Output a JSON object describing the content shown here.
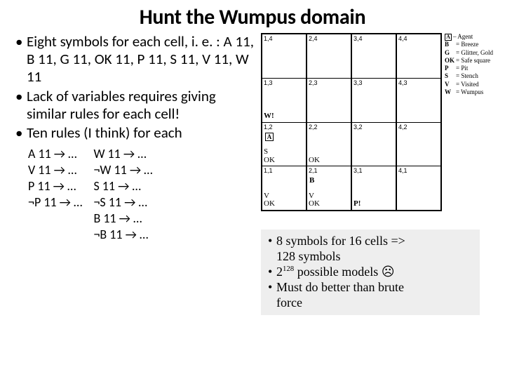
{
  "title": "Hunt the Wumpus domain",
  "bullets": {
    "b1": "Eight symbols for each cell, i. e. : A 11, B 11, G 11, OK 11, P 11, S 11, V 11, W 11",
    "b2": "Lack of variables requires giving similar rules for each cell!",
    "b3": "Ten rules (I think) for each"
  },
  "rules": {
    "c1": {
      "r1": "A 11 → …",
      "r2": "V 11 → …",
      "r3": "P 11 → …",
      "r4": "¬P 11 → …"
    },
    "c2": {
      "r1": "W 11 → …",
      "r2": "¬W 11 → …",
      "r3": "S 11 → …",
      "r4": "¬S 11 → …",
      "r5": "B 11 → …",
      "r6": "¬B 11 → …"
    }
  },
  "grid": {
    "c14": "1,4",
    "c24": "2,4",
    "c34": "3,4",
    "c44": "4,4",
    "c13": "1,3",
    "c23": "2,3",
    "c33": "3,3",
    "c43": "4,3",
    "c12": "1,2",
    "c22": "2,2",
    "c32": "3,2",
    "c42": "4,2",
    "c11": "1,1",
    "c21": "2,1",
    "c31": "3,1",
    "c41": "4,1",
    "t13": "W!",
    "t12a": "A",
    "t12b": "S\nOK",
    "t22": "OK",
    "t11": "V\nOK",
    "t21a": "B",
    "t21b": "V\nOK",
    "t31": "P!"
  },
  "legend": {
    "l1": "– Agent",
    "l1s": "A",
    "l2": "= Breeze",
    "l2s": "B",
    "l3": "= Glitter, Gold",
    "l3s": "G",
    "l4": "= Safe square",
    "l4s": "OK",
    "l5": "= Pit",
    "l5s": "P",
    "l6": "= Stench",
    "l6s": "S",
    "l7": "= Visited",
    "l7s": "V",
    "l8": "= Wumpus",
    "l8s": "W"
  },
  "summary": {
    "s1a": "8 symbols for 16 cells =>",
    "s1b": "128 symbols",
    "s2a": "2",
    "s2b": "128",
    "s2c": " possible models  ☹",
    "s3a": "Must do better than brute",
    "s3b": "force"
  }
}
